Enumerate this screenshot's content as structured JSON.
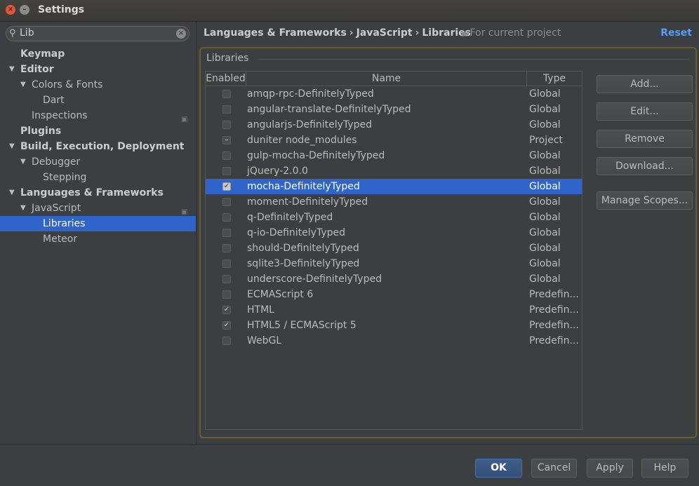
{
  "window": {
    "title": "Settings",
    "close_glyph": "×",
    "minimize_glyph": "–"
  },
  "search": {
    "value": "Lib",
    "icon": "search-icon",
    "clear_glyph": "×"
  },
  "sidebar": {
    "items": [
      {
        "label": "Keymap"
      },
      {
        "label": "Editor"
      },
      {
        "label": "Colors & Fonts"
      },
      {
        "label": "Dart"
      },
      {
        "label": "Inspections"
      },
      {
        "label": "Plugins"
      },
      {
        "label": "Build, Execution, Deployment"
      },
      {
        "label": "Debugger"
      },
      {
        "label": "Stepping"
      },
      {
        "label": "Languages & Frameworks"
      },
      {
        "label": "JavaScript"
      },
      {
        "label": "Libraries"
      },
      {
        "label": "Meteor"
      }
    ]
  },
  "breadcrumb": {
    "parts": [
      "Languages & Frameworks",
      "JavaScript",
      "Libraries"
    ],
    "separator": "›",
    "scope": "For current project"
  },
  "reset_label": "Reset",
  "group": {
    "title": "Libraries"
  },
  "table": {
    "columns": [
      "Enabled",
      "Name",
      "Type"
    ],
    "rows": [
      {
        "name": "amqp-rpc-DefinitelyTyped",
        "type": "Global",
        "enabled": "unchecked"
      },
      {
        "name": "angular-translate-DefinitelyTyped",
        "type": "Global",
        "enabled": "unchecked"
      },
      {
        "name": "angularjs-DefinitelyTyped",
        "type": "Global",
        "enabled": "unchecked"
      },
      {
        "name": "duniter node_modules",
        "type": "Project",
        "enabled": "indeterminate"
      },
      {
        "name": "gulp-mocha-DefinitelyTyped",
        "type": "Global",
        "enabled": "unchecked"
      },
      {
        "name": "jQuery-2.0.0",
        "type": "Global",
        "enabled": "unchecked"
      },
      {
        "name": "mocha-DefinitelyTyped",
        "type": "Global",
        "enabled": "checked",
        "selected": true
      },
      {
        "name": "moment-DefinitelyTyped",
        "type": "Global",
        "enabled": "unchecked"
      },
      {
        "name": "q-DefinitelyTyped",
        "type": "Global",
        "enabled": "unchecked"
      },
      {
        "name": "q-io-DefinitelyTyped",
        "type": "Global",
        "enabled": "unchecked"
      },
      {
        "name": "should-DefinitelyTyped",
        "type": "Global",
        "enabled": "unchecked"
      },
      {
        "name": "sqlite3-DefinitelyTyped",
        "type": "Global",
        "enabled": "unchecked"
      },
      {
        "name": "underscore-DefinitelyTyped",
        "type": "Global",
        "enabled": "unchecked"
      },
      {
        "name": "ECMAScript 6",
        "type": "Predefin...",
        "enabled": "unchecked"
      },
      {
        "name": "HTML",
        "type": "Predefin...",
        "enabled": "checked"
      },
      {
        "name": "HTML5 / ECMAScript 5",
        "type": "Predefin...",
        "enabled": "checked"
      },
      {
        "name": "WebGL",
        "type": "Predefin...",
        "enabled": "unchecked"
      }
    ]
  },
  "actions": {
    "add": "Add...",
    "edit": "Edit...",
    "remove": "Remove",
    "download": "Download...",
    "manage_scopes": "Manage Scopes..."
  },
  "footer": {
    "ok": "OK",
    "cancel": "Cancel",
    "apply": "Apply",
    "help": "Help"
  },
  "colors": {
    "selection": "#2f65ca",
    "link": "#589df6",
    "group_border": "#6b5a2a"
  }
}
